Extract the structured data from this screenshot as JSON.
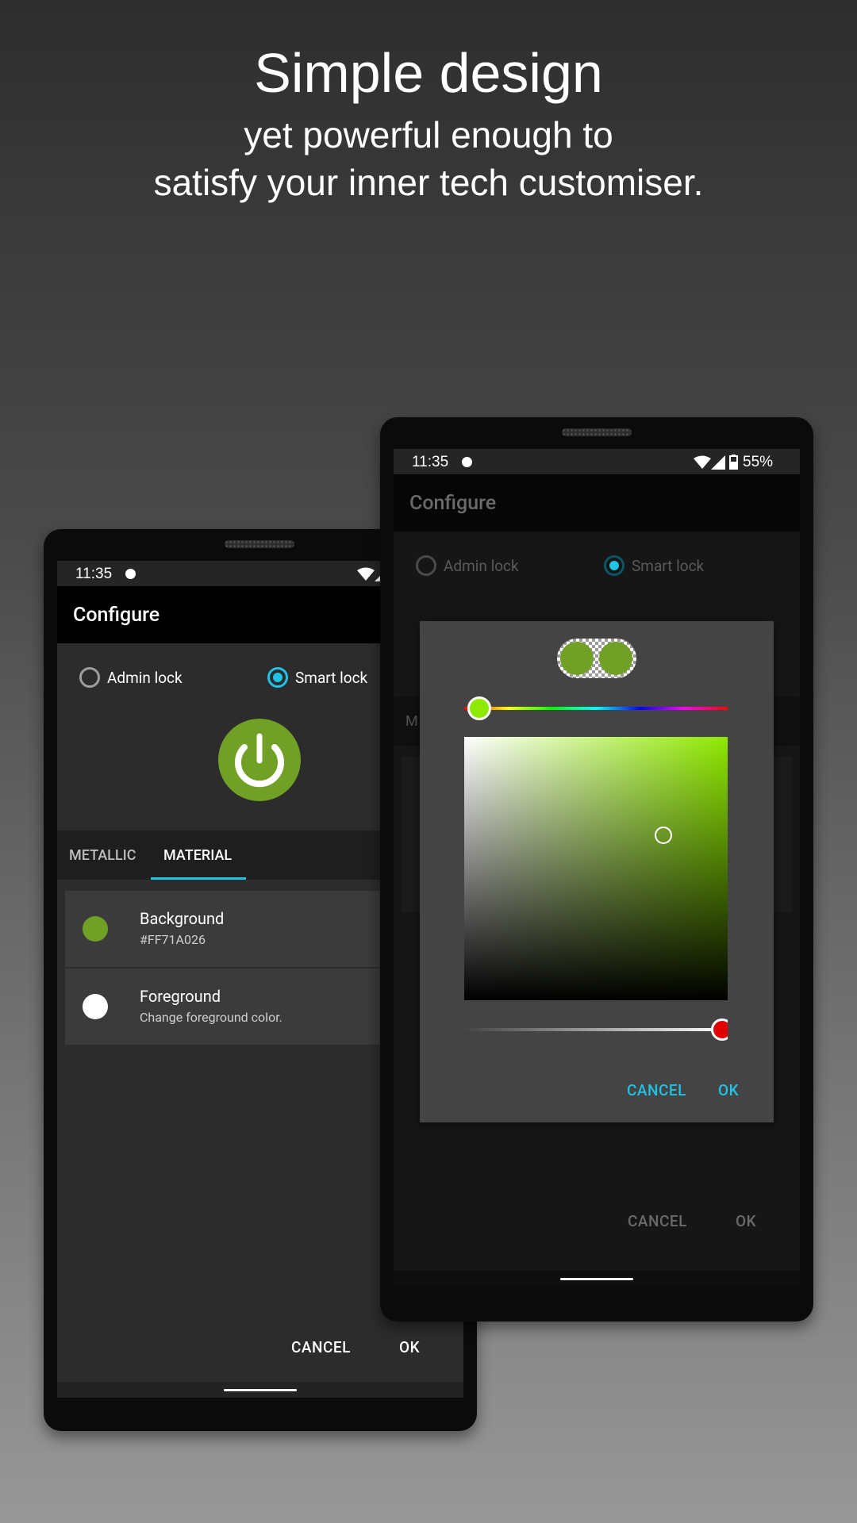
{
  "headline": {
    "title": "Simple design",
    "line1": "yet powerful enough to",
    "line2": "satisfy your inner tech customiser."
  },
  "front_phone": {
    "status_time": "11:35",
    "app_title": "Configure",
    "radio_admin": "Admin lock",
    "radio_smart": "Smart lock",
    "selected_radio": "Smart lock",
    "tabs": [
      "METALLIC",
      "MATERIAL"
    ],
    "active_tab": "MATERIAL",
    "items": [
      {
        "title": "Background",
        "subtitle": "#FF71A026",
        "swatch": "#71a026"
      },
      {
        "title": "Foreground",
        "subtitle": "Change foreground color.",
        "swatch": "#ffffff"
      }
    ],
    "cancel": "CANCEL",
    "ok": "OK"
  },
  "back_phone": {
    "status_time": "11:35",
    "battery": "55%",
    "app_title": "Configure",
    "radio_admin": "Admin lock",
    "radio_smart": "Smart lock",
    "tab_partial": "M",
    "cancel": "CANCEL",
    "ok": "OK"
  },
  "color_dialog": {
    "selected_color": "#71a026",
    "hue_color": "#8fe800",
    "alpha_color": "#e00000",
    "cancel": "CANCEL",
    "ok": "OK"
  },
  "colors": {
    "accent": "#1ec3e6",
    "power_green": "#71a026",
    "toolbar": "#000000",
    "panel": "#2c2c2c",
    "dialog": "#444444"
  }
}
